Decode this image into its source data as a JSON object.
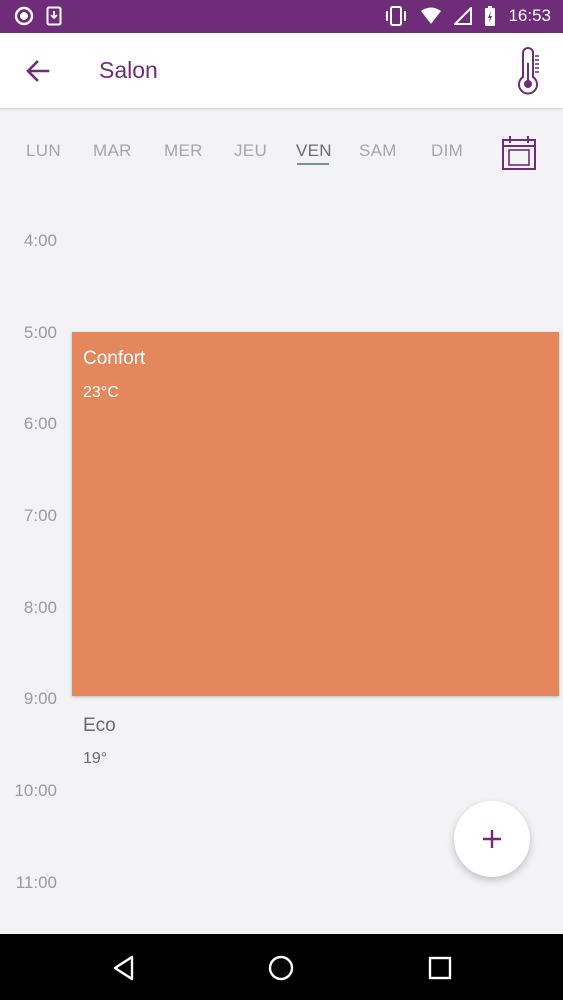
{
  "status_bar": {
    "time": "16:53",
    "icons": [
      "record-icon",
      "download-icon",
      "vibrate-icon",
      "wifi-icon",
      "no-signal-icon",
      "battery-charging-icon"
    ]
  },
  "app_bar": {
    "title": "Salon",
    "back_icon": "arrow-back-icon",
    "action_icon": "thermometer-icon"
  },
  "days": {
    "items": [
      "LUN",
      "MAR",
      "MER",
      "JEU",
      "VEN",
      "SAM",
      "DIM"
    ],
    "selected": "VEN",
    "calendar_icon": "calendar-icon"
  },
  "schedule": {
    "hours": [
      "4:00",
      "5:00",
      "6:00",
      "7:00",
      "8:00",
      "9:00",
      "10:00",
      "11:00"
    ],
    "slots": [
      {
        "name": "Confort",
        "temperature": "23°C",
        "start": "5:00",
        "end": "9:00",
        "color": "#e3875c"
      },
      {
        "name": "Eco",
        "temperature": "19°"
      }
    ]
  },
  "fab": {
    "icon": "plus-icon"
  },
  "nav_bar": {
    "icons": [
      "back-triangle-icon",
      "home-circle-icon",
      "recents-square-icon"
    ]
  },
  "colors": {
    "primary": "#6f2c78",
    "confort": "#e3875c",
    "underline": "#6e9a8a"
  }
}
